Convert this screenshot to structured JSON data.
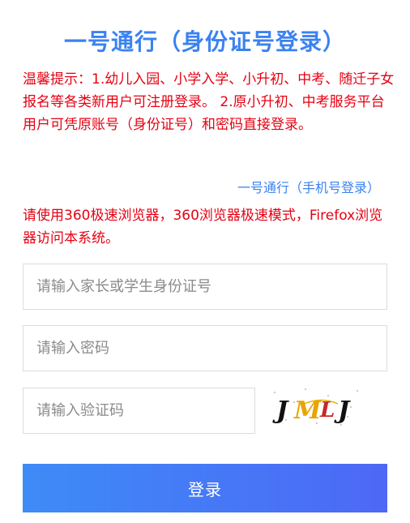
{
  "header": {
    "title": "一号通行（身份证号登录）"
  },
  "notice": {
    "text": "温馨提示：1.幼儿入园、小学入学、小升初、中考、随迁子女报名等各类新用户可注册登录。 2.原小升初、中考服务平台用户可凭原账号（身份证号）和密码直接登录。"
  },
  "links": {
    "phone_login": "一号通行（手机号登录）"
  },
  "browser_hint": {
    "text": "请使用360极速浏览器，360浏览器极速模式，Firefox浏览器访问本系统。"
  },
  "form": {
    "id_placeholder": "请输入家长或学生身份证号",
    "id_value": "",
    "password_placeholder": "请输入密码",
    "password_value": "",
    "captcha_placeholder": "请输入验证码",
    "captcha_value": "",
    "captcha_image_text": "JMLJ",
    "login_label": "登录"
  },
  "colors": {
    "title": "#3b82f0",
    "notice": "#e60012",
    "button_start": "#3e8bf7",
    "button_end": "#4d68f6"
  }
}
